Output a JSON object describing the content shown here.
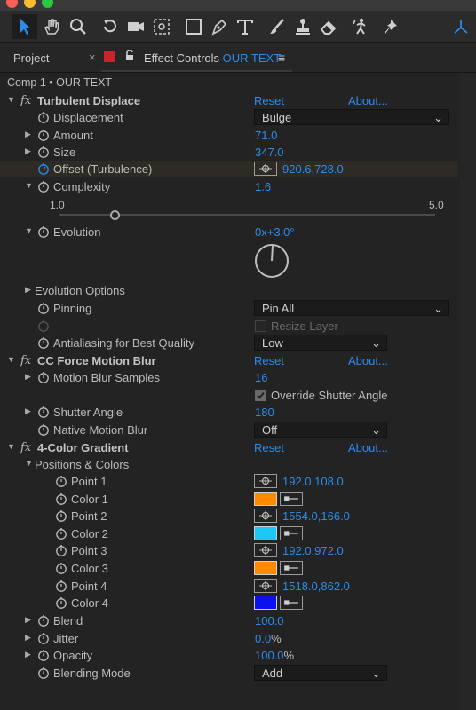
{
  "toolbar": {
    "tools": [
      "selection-tool",
      "hand-tool",
      "zoom-tool",
      "rotate-tool",
      "camera-tool",
      "pan-behind-tool",
      "rectangle-tool",
      "pen-tool",
      "type-tool",
      "brush-tool",
      "clone-stamp-tool",
      "eraser-tool",
      "roto-brush-tool",
      "puppet-tool",
      "workspace-tool"
    ]
  },
  "tabs": {
    "project": "Project",
    "close": "×",
    "effect_controls": "Effect Controls",
    "layer_name": "OUR TEXT",
    "menu": "≡"
  },
  "breadcrumb": "Comp 1 • OUR TEXT",
  "effects": {
    "turbulent": {
      "name": "Turbulent Displace",
      "reset": "Reset",
      "about": "About...",
      "displacement_label": "Displacement",
      "displacement_value": "Bulge",
      "amount_label": "Amount",
      "amount_value": "71.0",
      "size_label": "Size",
      "size_value": "347.0",
      "offset_label": "Offset (Turbulence)",
      "offset_value": "920.6,728.0",
      "complexity_label": "Complexity",
      "complexity_value": "1.6",
      "complexity_min": "1.0",
      "complexity_max": "5.0",
      "complexity_fraction": 0.15,
      "evolution_label": "Evolution",
      "evolution_value": "0x+3.0°",
      "evolution_options_label": "Evolution Options",
      "pinning_label": "Pinning",
      "pinning_value": "Pin All",
      "resize_layer_label": "Resize Layer",
      "antialiasing_label": "Antialiasing for Best Quality",
      "antialiasing_value": "Low"
    },
    "ccforce": {
      "name": "CC Force Motion Blur",
      "reset": "Reset",
      "about": "About...",
      "samples_label": "Motion Blur Samples",
      "samples_value": "16",
      "override_label": "Override Shutter Angle",
      "shutter_label": "Shutter Angle",
      "shutter_value": "180",
      "native_label": "Native Motion Blur",
      "native_value": "Off"
    },
    "gradient": {
      "name": "4-Color Gradient",
      "reset": "Reset",
      "about": "About...",
      "positions_label": "Positions & Colors",
      "point1_label": "Point 1",
      "point1_value": "192.0,108.0",
      "color1_label": "Color 1",
      "color1": "#ff8a00",
      "point2_label": "Point 2",
      "point2_value": "1554.0,166.0",
      "color2_label": "Color 2",
      "color2": "#1ec8f5",
      "point3_label": "Point 3",
      "point3_value": "192.0,972.0",
      "color3_label": "Color 3",
      "color3": "#ff8a00",
      "point4_label": "Point 4",
      "point4_value": "1518.0,862.0",
      "color4_label": "Color 4",
      "color4": "#0a10f0",
      "blend_label": "Blend",
      "blend_value": "100.0",
      "jitter_label": "Jitter",
      "jitter_value": "0.0",
      "jitter_unit": "%",
      "opacity_label": "Opacity",
      "opacity_value": "100.0",
      "opacity_unit": "%",
      "blending_label": "Blending Mode",
      "blending_value": "Add"
    }
  },
  "colors": {
    "accent_blue": "#2d8ceb",
    "tab_swatch": "#c8242b"
  }
}
